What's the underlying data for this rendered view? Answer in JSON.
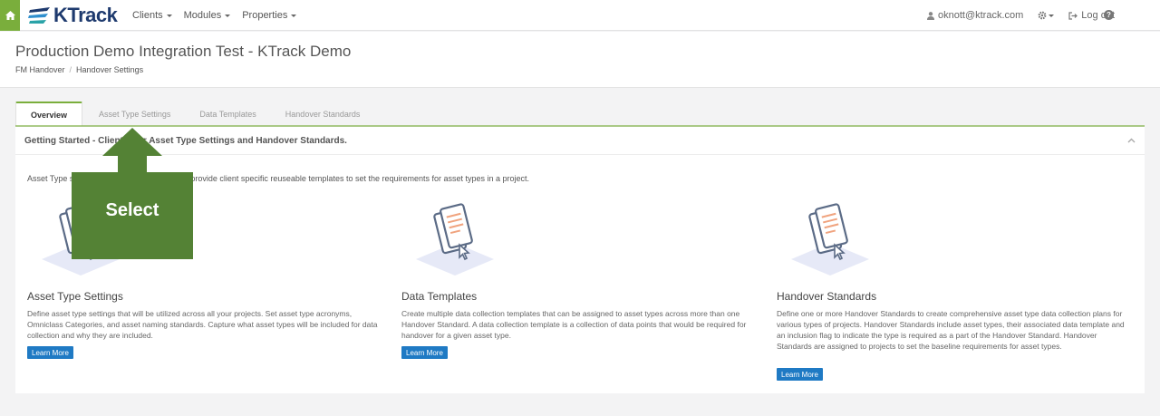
{
  "nav": {
    "logo_text": "KTrack",
    "menu": [
      {
        "label": "Clients"
      },
      {
        "label": "Modules"
      },
      {
        "label": "Properties"
      }
    ],
    "user_email": "oknott@ktrack.com",
    "logout_label": "Log out"
  },
  "header": {
    "title": "Production Demo Integration Test - KTrack Demo",
    "breadcrumb": [
      "FM Handover",
      "Handover Settings"
    ]
  },
  "tabs": [
    {
      "label": "Overview",
      "active": true
    },
    {
      "label": "Asset Type Settings",
      "active": false
    },
    {
      "label": "Data Templates",
      "active": false
    },
    {
      "label": "Handover Standards",
      "active": false
    }
  ],
  "panel": {
    "title_start": "Getting Started - Client",
    "title_end": "r Asset Type Settings and Handover Standards.",
    "intro_start": "Asset Type s",
    "intro_end": "provide client specific reuseable templates to set the requirements for asset types in a project."
  },
  "sections": [
    {
      "title": "Asset Type Settings",
      "description": "Define asset type settings that will be utilized across all your projects. Set asset type acronyms, Omniclass Categories, and asset naming standards. Capture what asset types will be included for data collection and why they are included.",
      "button": "Learn More"
    },
    {
      "title": "Data Templates",
      "description": "Create multiple data collection templates that can be assigned to asset types across more than one Handover Standard. A data collection template is a collection of data points that would be required for handover for a given asset type.",
      "button": "Learn More"
    },
    {
      "title": "Handover Standards",
      "description": "Define one or more Handover Standards to create comprehensive asset type data collection plans for various types of projects. Handover Standards include asset types, their associated data template and an inclusion flag to indicate the type is required as a part of the Handover Standard. Handover Standards are assigned to projects to set the baseline requirements for asset types.",
      "button": "Learn More"
    }
  ],
  "annotation": {
    "label": "Select",
    "color": "#548235"
  },
  "colors": {
    "accent_green": "#7aae3c",
    "button_blue": "#1f7ac4"
  }
}
